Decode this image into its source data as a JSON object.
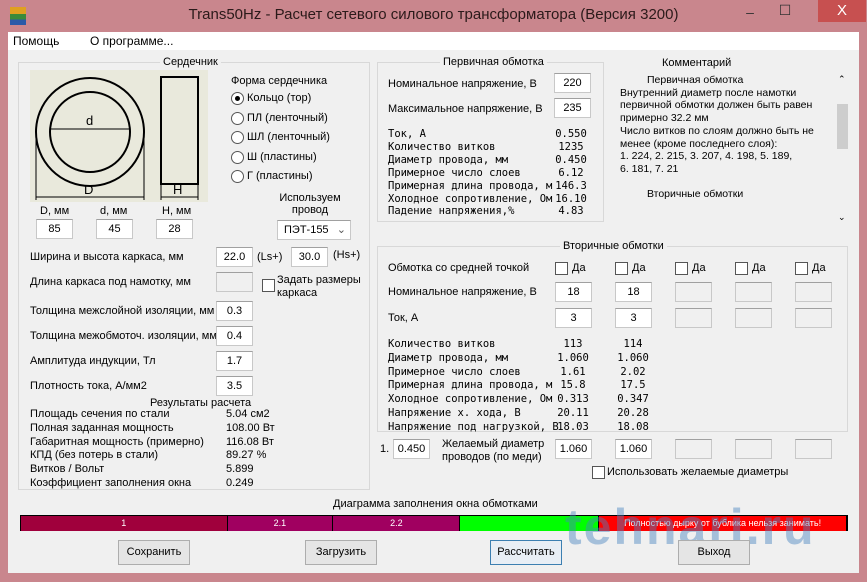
{
  "window": {
    "title": "Trans50Hz - Расчет сетевого силового трансформатора (Версия 3200)",
    "minimize": "–",
    "maximize": "☐",
    "close": "X"
  },
  "menu": [
    "Помощь",
    "О программе..."
  ],
  "core": {
    "title": "Сердечник",
    "drawing_labels": {
      "d": "d",
      "D": "D",
      "H": "H"
    },
    "dims": [
      {
        "label": "D, мм",
        "value": "85"
      },
      {
        "label": "d, мм",
        "value": "45"
      },
      {
        "label": "H, мм",
        "value": "28"
      }
    ],
    "shape_title": "Форма сердечника",
    "shapes": [
      {
        "label": "Кольцо  (тор)",
        "selected": true
      },
      {
        "label": "ПЛ  (ленточный)",
        "selected": false
      },
      {
        "label": "ШЛ  (ленточный)",
        "selected": false
      },
      {
        "label": "Ш  (пластины)",
        "selected": false
      },
      {
        "label": "Г (пластины)",
        "selected": false
      }
    ],
    "wire_label": "Используем провод",
    "wire_value": "ПЭТ-155",
    "frame_label": "Ширина и высота каркаса, мм",
    "frame_w": "22.0",
    "ls": "(Ls+)",
    "frame_h": "30.0",
    "hs": "(Hs+)",
    "length_label": "Длина каркаса под намотку, мм",
    "length_value": "",
    "set_frame_label": "Задать размеры каркаса",
    "params": [
      {
        "label": "Толщина межслойной изоляции, мм",
        "value": "0.3"
      },
      {
        "label": "Толщина межобмоточ. изоляции, мм",
        "value": "0.4"
      },
      {
        "label": "Амплитуда индукции, Тл",
        "value": "1.7"
      },
      {
        "label": "Плотность тока, А/мм2",
        "value": "3.5"
      }
    ],
    "results_title": "Результаты расчета",
    "results": [
      {
        "label": "Площадь сечения по стали",
        "value": "5.04 см2"
      },
      {
        "label": "Полная заданная мощность",
        "value": "108.00 Вт"
      },
      {
        "label": "Габаритная мощность (примерно)",
        "value": "116.08 Вт"
      },
      {
        "label": "КПД (без потерь в стали)",
        "value": "89.27 %"
      },
      {
        "label": "Витков / Вольт",
        "value": "5.899"
      },
      {
        "label": "Коэффициент заполнения окна",
        "value": "0.249"
      }
    ]
  },
  "primary": {
    "title": "Первичная обмотка",
    "nominal_label": "Номинальное напряжение, В",
    "nominal": "220",
    "max_label": "Максимальное напряжение, В",
    "max": "235",
    "rows": [
      {
        "label": "Ток, А",
        "value": "0.550"
      },
      {
        "label": "Количество витков",
        "value": "1235"
      },
      {
        "label": "Диаметр провода, мм",
        "value": "0.450"
      },
      {
        "label": "Примерное число слоев",
        "value": "6.12"
      },
      {
        "label": "Примерная длина провода, м",
        "value": "146.3"
      },
      {
        "label": "Холодное сопротивление, Ом",
        "value": "16.10"
      },
      {
        "label": "Падение напряжения,%",
        "value": "4.83"
      }
    ]
  },
  "comment": {
    "title": "Комментарий",
    "lines": [
      "Первичная обмотка",
      "Внутренний диаметр после намотки",
      "первичной обмотки должен быть равен",
      "примерно 32.2 мм",
      "Число витков по слоям должно быть не",
      "менее (кроме последнего слоя):",
      "1. 224,  2. 215,  3. 207,  4. 198,  5. 189,",
      "6. 181,  7. 21",
      "",
      "Вторичные обмотки"
    ]
  },
  "secondary": {
    "title": "Вторичные обмотки",
    "center_tap_label": "Обмотка со средней точкой",
    "yes": "Да",
    "nominal_label": "Номинальное напряжение, В",
    "current_label": "Ток, А",
    "nominal": [
      "18",
      "18",
      "",
      "",
      ""
    ],
    "current": [
      "3",
      "3",
      "",
      "",
      ""
    ],
    "row_labels": [
      "Количество витков",
      "Диаметр провода, мм",
      "Примерное число слоев",
      "Примерная длина провода, м",
      "Холодное сопротивление, Ом",
      "Напряжение х. хода, В",
      "Напряжение под нагрузкой, В"
    ],
    "col1": [
      "113",
      "1.060",
      "1.61",
      "15.8",
      "0.313",
      "20.11",
      "18.03"
    ],
    "col2": [
      "114",
      "1.060",
      "2.02",
      "17.5",
      "0.347",
      "20.28",
      "18.08"
    ]
  },
  "desired": {
    "num": "1.",
    "primary": "0.450",
    "label": "Желаемый диаметр проводов  (по меди)",
    "values": [
      "1.060",
      "1.060",
      "",
      "",
      ""
    ],
    "use_label": "Использовать желаемые диаметры"
  },
  "diagram": {
    "title": "Диаграмма заполнения окна обмотками",
    "segments": [
      {
        "label": "1",
        "fraction": 0.25
      },
      {
        "label": "2.1",
        "fraction": 0.128
      },
      {
        "label": "2.2",
        "fraction": 0.154
      },
      {
        "label": "",
        "fraction": 0.168
      },
      {
        "label": "Полностью дырку от бублика нельзя занимать!",
        "fraction": 0.3
      }
    ],
    "colors": [
      "#a0003c",
      "#a00060",
      "#a00060",
      "#00ff00",
      "#ff0000"
    ]
  },
  "buttons": {
    "save": "Сохранить",
    "load": "Загрузить",
    "calc": "Рассчитать",
    "exit": "Выход"
  },
  "watermark": "tehnari.ru"
}
